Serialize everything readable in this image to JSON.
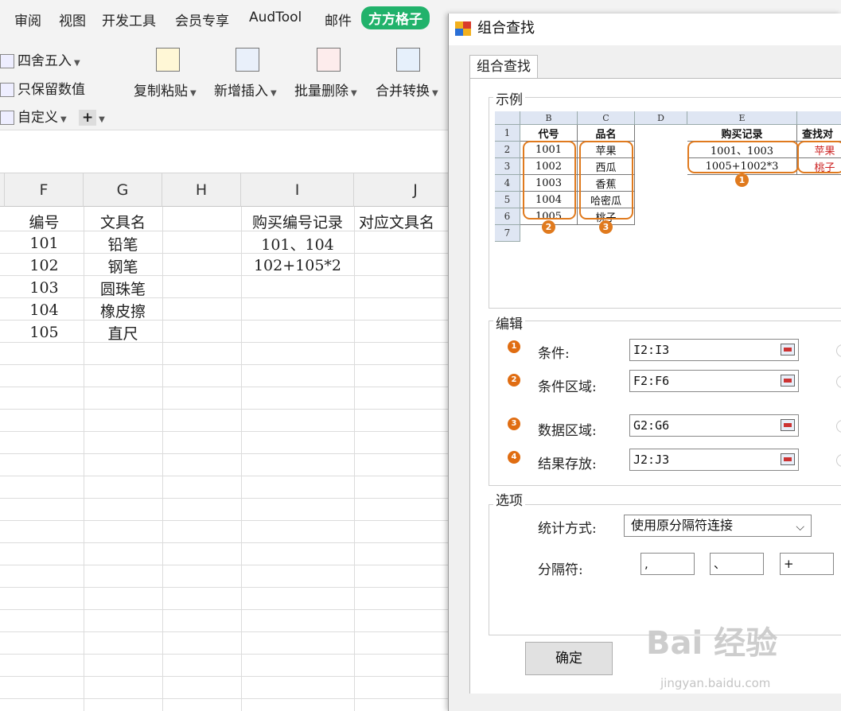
{
  "ribbon_tabs": [
    {
      "label": "审阅"
    },
    {
      "label": "视图"
    },
    {
      "label": "开发工具"
    },
    {
      "label": "会员专享"
    },
    {
      "label": "AudTool"
    },
    {
      "label": "邮件"
    },
    {
      "label": "方方格子"
    }
  ],
  "ribbon": {
    "round_label": "四舍五入",
    "keep_values_label": "只保留数值",
    "custom_label": "自定义",
    "copy_paste_label": "复制粘贴",
    "insert_label": "新增插入",
    "batch_delete_label": "批量删除",
    "merge_convert_label": "合并转换"
  },
  "sheet": {
    "columns": [
      "F",
      "G",
      "H",
      "I",
      "J"
    ],
    "headers": {
      "F": "编号",
      "G": "文具名",
      "I": "购买编号记录",
      "J": "对应文具名"
    },
    "rows": [
      {
        "F": "101",
        "G": "铅笔",
        "I": "101、104"
      },
      {
        "F": "102",
        "G": "钢笔",
        "I": "102+105*2"
      },
      {
        "F": "103",
        "G": "圆珠笔",
        "I": ""
      },
      {
        "F": "104",
        "G": "橡皮擦",
        "I": ""
      },
      {
        "F": "105",
        "G": "直尺",
        "I": ""
      }
    ]
  },
  "dialog": {
    "title": "组合查找",
    "tab": "组合查找",
    "example_group": "示例",
    "example": {
      "col_headers": [
        "B",
        "C",
        "D",
        "E"
      ],
      "row_numbers": [
        "1",
        "2",
        "3",
        "4",
        "5",
        "6",
        "7"
      ],
      "B": [
        "代号",
        "1001",
        "1002",
        "1003",
        "1004",
        "1005"
      ],
      "C": [
        "品名",
        "苹果",
        "西瓜",
        "香蕉",
        "哈密瓜",
        "桃子"
      ],
      "E": [
        "购买记录",
        "1001、1003",
        "1005+1002*3"
      ],
      "F": [
        "查找对",
        "苹果",
        "桃子"
      ],
      "badges": [
        "1",
        "2",
        "3"
      ]
    },
    "edit_group": "编辑",
    "condition_label": "条件:",
    "condition_value": "I2:I3",
    "condition_range_label": "条件区域:",
    "condition_range_value": "F2:F6",
    "data_range_label": "数据区域:",
    "data_range_value": "G2:G6",
    "result_label": "结果存放:",
    "result_value": "J2:J3",
    "options_group": "选项",
    "stat_method_label": "统计方式:",
    "stat_method_value": "使用原分隔符连接",
    "separator_label": "分隔符:",
    "separators": [
      ",",
      "、",
      "+"
    ],
    "ok_label": "确定"
  },
  "watermark": {
    "main": "Bai 经验",
    "sub": "jingyan.baidu.com"
  },
  "colors": {
    "accent": "#21b26b",
    "highlight": "#e07a1e",
    "red_text": "#cc2222"
  }
}
